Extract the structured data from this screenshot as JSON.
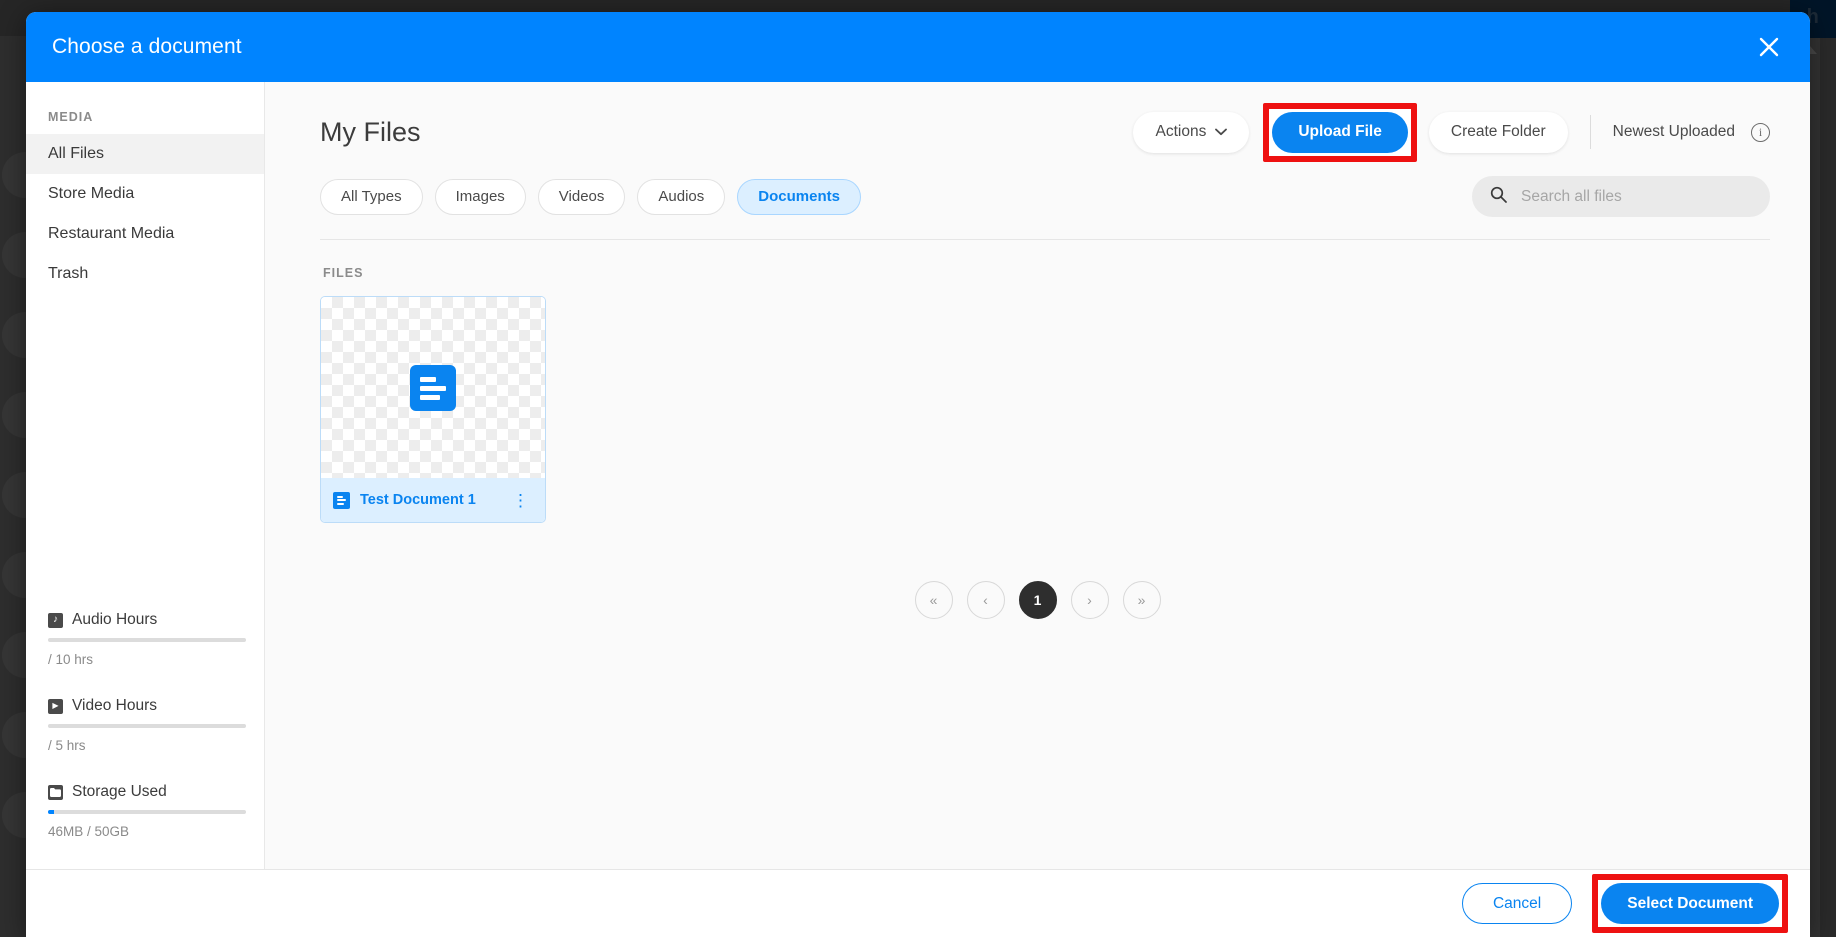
{
  "modal": {
    "title": "Choose a document",
    "close_icon": "close-icon"
  },
  "sidebar": {
    "section_label": "MEDIA",
    "items": [
      {
        "label": "All Files",
        "active": true
      },
      {
        "label": "Store Media",
        "active": false
      },
      {
        "label": "Restaurant Media",
        "active": false
      },
      {
        "label": "Trash",
        "active": false
      }
    ],
    "quotas": [
      {
        "name": "Audio Hours",
        "icon": "music-note-icon",
        "glyph": "♪",
        "value_text": "/ 10 hrs",
        "fill_percent": 0
      },
      {
        "name": "Video Hours",
        "icon": "play-icon",
        "glyph": "▶",
        "value_text": "/ 5 hrs",
        "fill_percent": 0
      },
      {
        "name": "Storage Used",
        "icon": "folder-icon",
        "glyph": "▬",
        "value_text": "46MB / 50GB",
        "fill_percent": 3
      }
    ]
  },
  "main": {
    "page_title": "My Files",
    "toolbar": {
      "actions_label": "Actions",
      "actions_caret_icon": "chevron-down-icon",
      "upload_label": "Upload File",
      "create_folder_label": "Create Folder",
      "sort_label": "Newest Uploaded",
      "info_icon": "info-icon",
      "info_glyph": "i"
    },
    "filters": [
      {
        "label": "All Types",
        "selected": false
      },
      {
        "label": "Images",
        "selected": false
      },
      {
        "label": "Videos",
        "selected": false
      },
      {
        "label": "Audios",
        "selected": false
      },
      {
        "label": "Documents",
        "selected": true
      }
    ],
    "search": {
      "placeholder": "Search all files",
      "value": "",
      "icon": "search-icon"
    },
    "files_label": "FILES",
    "files": [
      {
        "name": "Test Document 1",
        "selected": true,
        "type_icon": "document-icon",
        "menu_icon": "kebab-menu-icon",
        "menu_glyph": "⋮"
      }
    ],
    "pagination": {
      "first_label": "«",
      "prev_label": "‹",
      "pages": [
        "1"
      ],
      "current_page": "1",
      "next_label": "›",
      "last_label": "»"
    }
  },
  "footer": {
    "cancel_label": "Cancel",
    "select_label": "Select Document"
  },
  "colors": {
    "accent_blue": "#0a84f0",
    "header_blue": "#0084ff",
    "selected_chip_bg": "#dcefff",
    "highlight_red": "#ee1111",
    "dark_backdrop": "#2e2e2e"
  }
}
